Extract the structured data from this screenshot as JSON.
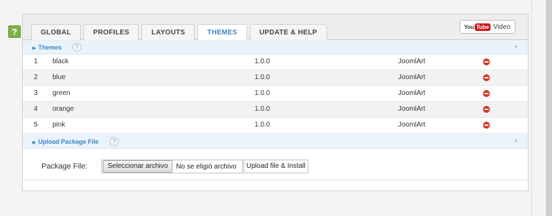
{
  "help_badge": "?",
  "tabs": [
    {
      "label": "GLOBAL"
    },
    {
      "label": "PROFILES"
    },
    {
      "label": "LAYOUTS"
    },
    {
      "label": "THEMES"
    },
    {
      "label": "UPDATE & HELP"
    }
  ],
  "video_button": {
    "you": "You",
    "tube": "Tube",
    "label": "Video"
  },
  "themes_section": {
    "title": "Themes",
    "help": "?",
    "rows": [
      {
        "index": "1",
        "name": "black",
        "version": "1.0.0",
        "author": "JoomlArt"
      },
      {
        "index": "2",
        "name": "blue",
        "version": "1.0.0",
        "author": "JoomlArt"
      },
      {
        "index": "3",
        "name": "green",
        "version": "1.0.0",
        "author": "JoomlArt"
      },
      {
        "index": "4",
        "name": "orange",
        "version": "1.0.0",
        "author": "JoomlArt"
      },
      {
        "index": "5",
        "name": "pink",
        "version": "1.0.0",
        "author": "JoomlArt"
      }
    ]
  },
  "upload_section": {
    "title": "Upload Package File",
    "help": "?",
    "label": "Package File:",
    "choose_button": "Seleccionar archivo",
    "file_status": "No se eligió archivo",
    "install_button": "Upload file & Install"
  },
  "icons": {
    "delete": "delete-circle-icon",
    "collapse": "collapse-arrow-icon",
    "expand": "section-arrow-icon"
  },
  "colors": {
    "accent": "#3a86c4",
    "delete": "#d9342b",
    "help_badge": "#7cb342",
    "youtube": "#cc181e"
  }
}
